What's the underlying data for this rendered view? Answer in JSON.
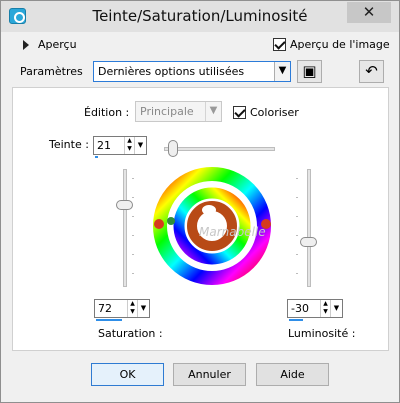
{
  "window": {
    "title": "Teinte/Saturation/Luminosité",
    "close_label": "✕"
  },
  "preview": {
    "label": "Aperçu",
    "image_preview_label": "Aperçu de l'image",
    "image_preview_checked": true
  },
  "parameters": {
    "label": "Paramètres",
    "preset_value": "Dernières options utilisées"
  },
  "edit": {
    "label": "Édition :",
    "value": "Principale",
    "colorize_label": "Coloriser",
    "colorize_checked": true
  },
  "hue": {
    "label": "Teinte :",
    "value": "21"
  },
  "saturation": {
    "label": "Saturation :",
    "value": "72"
  },
  "luminosity": {
    "label": "Luminosité :",
    "value": "-30"
  },
  "watermark": "Marnabelle",
  "buttons": {
    "ok": "OK",
    "cancel": "Annuler",
    "help": "Aide"
  },
  "icons": {
    "app": "hue-saturation-icon",
    "save": "save-preset-icon",
    "reset": "reset-preset-icon"
  }
}
